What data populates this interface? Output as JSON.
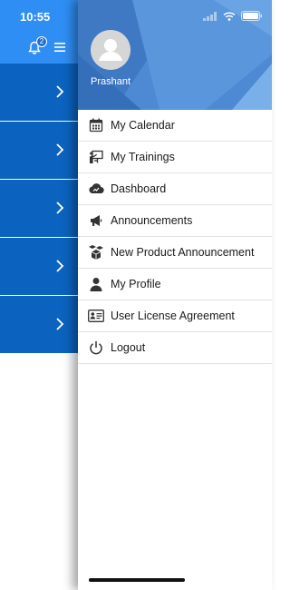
{
  "status_bar": {
    "time": "10:55",
    "icons": [
      "cellular-signal-icon",
      "wifi-icon",
      "battery-icon"
    ]
  },
  "background_app": {
    "notification_badge": "2",
    "header_color": "#2f8ef4",
    "row_color": "#0b63bf",
    "rows": [
      {
        "icon": "chevron-right-icon"
      },
      {
        "icon": "chevron-right-icon"
      },
      {
        "icon": "chevron-right-icon"
      },
      {
        "icon": "chevron-right-icon"
      },
      {
        "icon": "chevron-right-icon"
      }
    ]
  },
  "drawer": {
    "user": {
      "name": "Prashant",
      "avatar_icon": "user-avatar-icon"
    },
    "menu": [
      {
        "label": "My Calendar",
        "icon": "calendar-icon"
      },
      {
        "label": "My Trainings",
        "icon": "presentation-icon"
      },
      {
        "label": "Dashboard",
        "icon": "cloud-dashboard-icon"
      },
      {
        "label": "Announcements",
        "icon": "megaphone-icon"
      },
      {
        "label": "New Product Announcement",
        "icon": "boxes-icon"
      },
      {
        "label": "My Profile",
        "icon": "person-icon"
      },
      {
        "label": "User License Agreement",
        "icon": "id-card-icon"
      },
      {
        "label": "Logout",
        "icon": "power-icon"
      }
    ]
  }
}
